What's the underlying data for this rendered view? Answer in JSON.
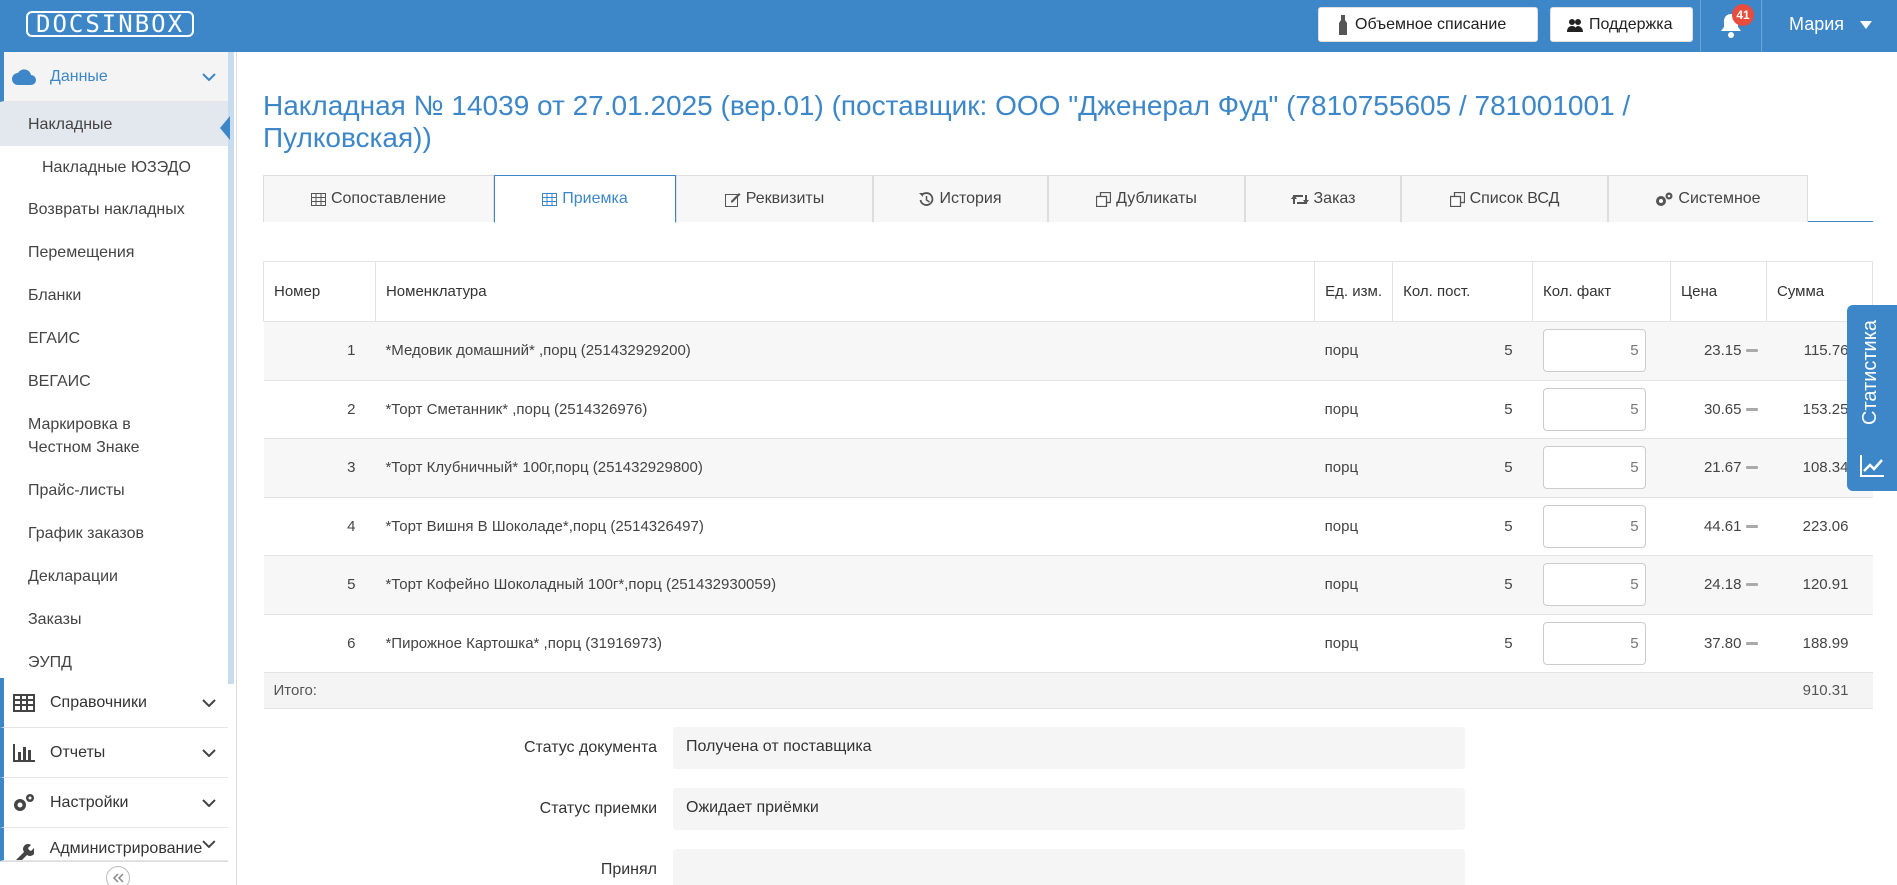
{
  "header": {
    "logo": "DOCSINBOX",
    "bulk_write_off": "Объемное списание",
    "support": "Поддержка",
    "notifications_count": "41",
    "user": "Мария"
  },
  "sidebar": {
    "groups": {
      "data": "Данные",
      "references": "Справочники",
      "reports": "Отчеты",
      "settings": "Настройки",
      "admin": "Администрирование"
    },
    "items": [
      "Накладные",
      "Накладные ЮЗЭДО",
      "Возвраты накладных",
      "Перемещения",
      "Бланки",
      "ЕГАИС",
      "ВЕГАИС",
      "Маркировка в Честном Знаке",
      "Прайс-листы",
      "График заказов",
      "Декларации",
      "Заказы",
      "ЭУПД"
    ]
  },
  "page": {
    "title": "Накладная № 14039 от 27.01.2025 (вер.01) (поставщик: ООО \"Дженерал Фуд\" (7810755605 / 781001001 / Пулковская))"
  },
  "tabs": [
    "Сопоставление",
    "Приемка",
    "Реквизиты",
    "История",
    "Дубликаты",
    "Заказ",
    "Список ВСД",
    "Системное"
  ],
  "table": {
    "headers": {
      "num": "Номер",
      "name": "Номенклатура",
      "unit": "Ед. изм.",
      "qty_sent": "Кол. пост.",
      "qty_fact": "Кол. факт",
      "price": "Цена",
      "sum": "Сумма"
    },
    "rows": [
      {
        "num": "1",
        "name": "*Медовик домашний* ,порц (251432929200)",
        "unit": "порц",
        "qty": "5",
        "fact": "5",
        "price": "23.15",
        "sum": "115.76"
      },
      {
        "num": "2",
        "name": "*Торт Сметанник* ,порц (2514326976)",
        "unit": "порц",
        "qty": "5",
        "fact": "5",
        "price": "30.65",
        "sum": "153.25"
      },
      {
        "num": "3",
        "name": "*Торт Клубничный* 100г,порц (251432929800)",
        "unit": "порц",
        "qty": "5",
        "fact": "5",
        "price": "21.67",
        "sum": "108.34"
      },
      {
        "num": "4",
        "name": "*Торт Вишня В Шоколаде*,порц (2514326497)",
        "unit": "порц",
        "qty": "5",
        "fact": "5",
        "price": "44.61",
        "sum": "223.06"
      },
      {
        "num": "5",
        "name": "*Торт Кофейно Шоколадный 100г*,порц (251432930059)",
        "unit": "порц",
        "qty": "5",
        "fact": "5",
        "price": "24.18",
        "sum": "120.91"
      },
      {
        "num": "6",
        "name": "*Пирожное Картошка* ,порц (31916973)",
        "unit": "порц",
        "qty": "5",
        "fact": "5",
        "price": "37.80",
        "sum": "188.99"
      }
    ],
    "total_label": "Итого:",
    "total_value": "910.31"
  },
  "statistics": "Статистика",
  "form": {
    "doc_status_label": "Статус документа",
    "doc_status_value": "Получена от поставщика",
    "accept_status_label": "Статус приемки",
    "accept_status_value": "Ожидает приёмки",
    "accepted_by_label": "Принял",
    "accepted_by_value": ""
  },
  "colors": {
    "brand": "#3d87c9",
    "badge": "#e74c3c"
  }
}
